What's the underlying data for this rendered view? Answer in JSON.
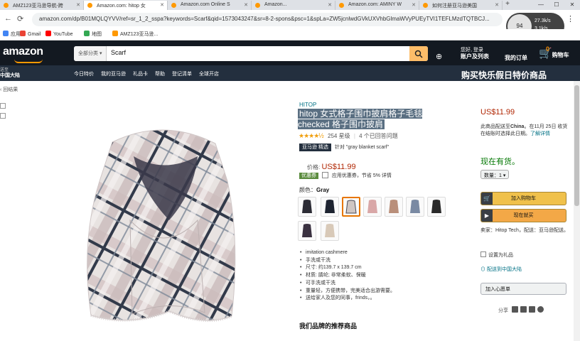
{
  "browser": {
    "tabs": [
      {
        "label": "AMZ123亚马逊导航-跨"
      },
      {
        "label": "Amazon.com: hitop 女"
      },
      {
        "label": "Amazon.com Online S"
      },
      {
        "label": "Amazon..."
      },
      {
        "label": "Amazon.com: AMINY W"
      },
      {
        "label": "如何注册亚马逊美国"
      }
    ],
    "url": "amazon.com/dp/B01MQLQYVV/ref=sr_1_2_sspa?keywords=Scarf&qid=1573043247&sr=8-2-spons&psc=1&spLa=ZW5jcnlwdGVkUXVhbGlmaWVyPUEyTVI1TEFLMzdTQTBCJ...",
    "profile": {
      "initials": "94",
      "stat1": "27.3k/s",
      "stat2": "3.1k/s"
    },
    "bookmarks": [
      "应用",
      "Gmail",
      "YouTube",
      "地图",
      "AMZ123亚马逊..."
    ]
  },
  "header": {
    "logo": "amazon",
    "search_category": "全部分类 ▾",
    "search_query": "Scarf",
    "account_line1": "您好, 登录",
    "account_line2": "账户及列表",
    "orders": "我的订单",
    "cart_count": "0",
    "cart_label": "购物车"
  },
  "subheader": {
    "loc_line1": "送至",
    "loc_line2": "中国大陆",
    "nav": [
      "今日特价",
      "我的亚马逊",
      "礼品卡",
      "帮助",
      "登记清单",
      "全球开店"
    ],
    "promo": "购买快乐假日特价商品"
  },
  "breadcrumb": "‹ 回结果",
  "product": {
    "brand": "HITOP",
    "title": "hitop 女式格子围巾披肩格子毛毯 checked 格子围巾披肩",
    "stars": "★★★★½",
    "ratings": "254 星级",
    "answered": "4 个已回答问题",
    "choice_badge": "亚马逊 精选",
    "choice_for": "针对 \"gray blanket scarf\"",
    "price_label": "价格:",
    "price": "US$11.99",
    "coupon_tag": "优惠券",
    "coupon_text": "应用优惠券，节省 5% 详情",
    "color_label": "颜色：",
    "color_value": "Gray",
    "bullets": [
      "imitation cashmere",
      "手洗或干洗",
      "尺寸: 约139.7 x 139.7 cm",
      "材质: 腈纶; 非常柔软、保暖",
      "可手洗或干洗",
      "重量轻，方便携带，完美适合出游需要。",
      "送给家人及您的同事，frinds，。"
    ],
    "rec_heading": "我们品牌的推荐商品"
  },
  "buybox": {
    "price": "US$11.99",
    "ship_text": "此商品配送至",
    "ship_bold": "China",
    "ship_text2": "。在11月 25日 收货在结账时选择此日期。",
    "ship_link": "了解详情",
    "stock": "现在有货。",
    "qty": "数量：1 ▾",
    "add_cart": "加入购物车",
    "buy_now": "现在就买",
    "seller_text": "卖家：Hitop Tech，配送：亚马逊配送。",
    "gift": "设置为礼品",
    "address": "配送到中国大陆",
    "wishlist": "加入心愿单",
    "share": "分享"
  },
  "colors": {
    "amazon_dark": "#131921",
    "amazon_nav": "#232f3e",
    "accent": "#ff9900",
    "price": "#b12704"
  }
}
